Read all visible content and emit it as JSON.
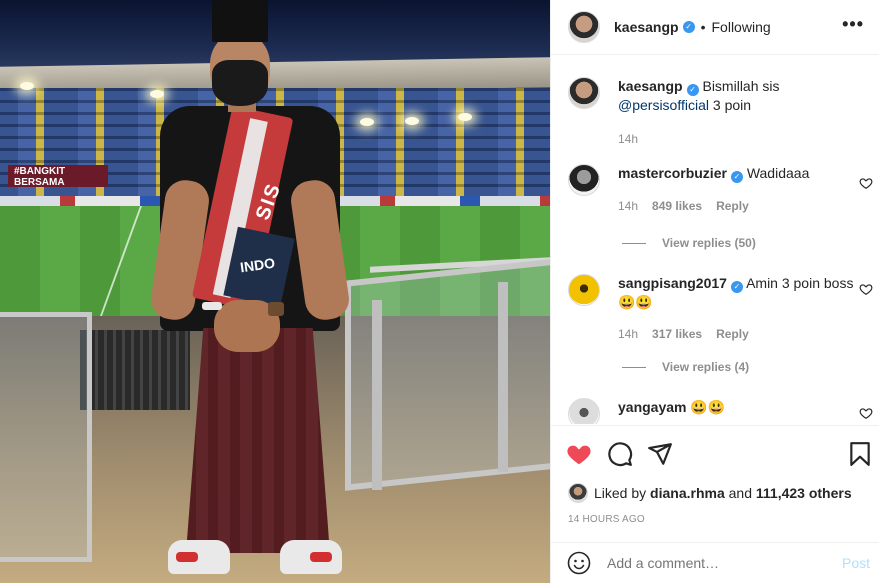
{
  "photo": {
    "banner_text": "#BANGKIT BERSAMA",
    "scarf_text": "SIS",
    "scarf_text_2": "INDO"
  },
  "header": {
    "username": "kaesangp",
    "separator": "•",
    "follow_status": "Following",
    "more_icon": "more-horizontal-icon"
  },
  "caption": {
    "username": "kaesangp",
    "text_before": "Bismillah sis ",
    "mention": "@persisofficial",
    "text_after": " 3 poin",
    "time": "14h"
  },
  "comments": [
    {
      "username": "mastercorbuzier",
      "text": "Wadidaaa",
      "time": "14h",
      "likes": "849 likes",
      "reply_label": "Reply",
      "view_replies": "View replies (50)"
    },
    {
      "username": "sangpisang2017",
      "text": "Amin 3 poin boss😃😃",
      "time": "14h",
      "likes": "317 likes",
      "reply_label": "Reply",
      "view_replies": "View replies (4)"
    },
    {
      "username": "yangayam",
      "text": "😃😃"
    }
  ],
  "likes": {
    "prefix": "Liked by",
    "user": "diana.rhma",
    "middle": "and",
    "count": "111,423 others"
  },
  "timestamp": "14 HOURS AGO",
  "add_comment": {
    "placeholder": "Add a comment…",
    "post_label": "Post"
  },
  "colors": {
    "heart_red": "#ed4956",
    "verified_blue": "#3897f0",
    "mention_blue": "#00376b",
    "muted_gray": "#8e8e8e",
    "post_disabled": "#b2dffc"
  }
}
